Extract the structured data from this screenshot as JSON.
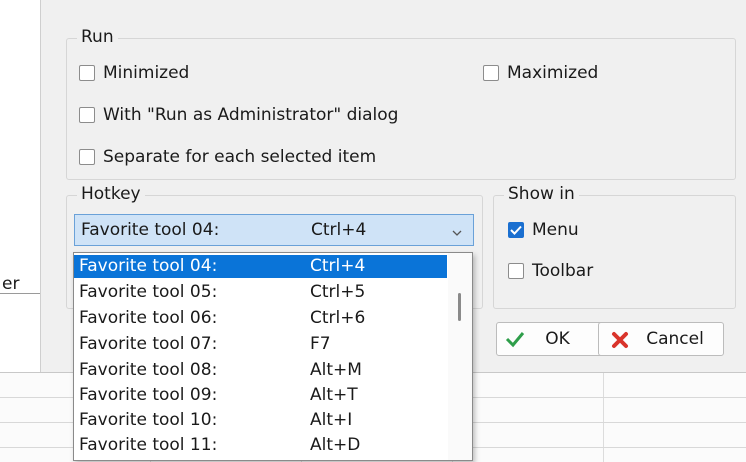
{
  "background": {
    "partial_text": "er"
  },
  "run_group": {
    "title": "Run",
    "minimized": {
      "label": "Minimized",
      "checked": false
    },
    "maximized": {
      "label": "Maximized",
      "checked": false
    },
    "run_as_admin": {
      "label": "With \"Run as Administrator\" dialog",
      "checked": false
    },
    "separate": {
      "label": "Separate for each selected item",
      "checked": false
    }
  },
  "hotkey_group": {
    "title": "Hotkey",
    "selected_name": "Favorite tool 04:",
    "selected_key": "Ctrl+4"
  },
  "showin_group": {
    "title": "Show in",
    "menu": {
      "label": "Menu",
      "checked": true
    },
    "toolbar": {
      "label": "Toolbar",
      "checked": false
    }
  },
  "buttons": {
    "ok": "OK",
    "cancel": "Cancel"
  },
  "dropdown": {
    "items": [
      {
        "name": "Favorite tool 04:",
        "key": "Ctrl+4",
        "selected": true
      },
      {
        "name": "Favorite tool 05:",
        "key": "Ctrl+5"
      },
      {
        "name": "Favorite tool 06:",
        "key": "Ctrl+6"
      },
      {
        "name": "Favorite tool 07:",
        "key": "F7"
      },
      {
        "name": "Favorite tool 08:",
        "key": "Alt+M"
      },
      {
        "name": "Favorite tool 09:",
        "key": "Alt+T"
      },
      {
        "name": "Favorite tool 10:",
        "key": "Alt+I"
      },
      {
        "name": "Favorite tool 11:",
        "key": "Alt+D"
      }
    ]
  },
  "colors": {
    "accent": "#0a74d8",
    "checkbox_checked": "#1a6fd0",
    "cancel_icon": "#d9342b",
    "ok_icon": "#2e9e4a"
  }
}
